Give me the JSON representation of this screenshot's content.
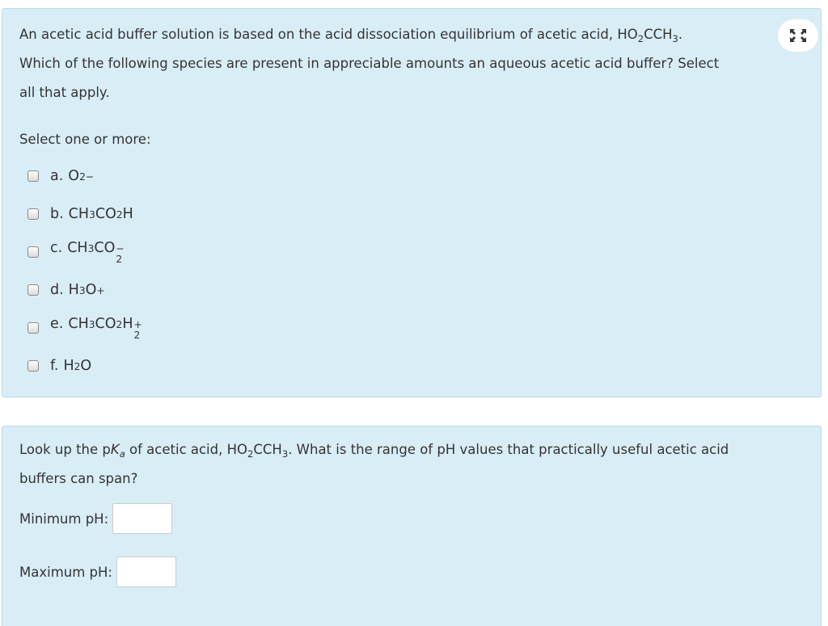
{
  "question1": {
    "line1": {
      "pre": "An acetic acid buffer solution is based on the acid dissociation equilibrium of acetic acid, HO",
      "sub1": "2",
      "mid": "CCH",
      "sub2": "3",
      "post": "."
    },
    "line2": "Which of the following species are present in appreciable amounts an aqueous acetic acid buffer? Select",
    "line3": "all that apply.",
    "prompt": "Select one or more:",
    "options": [
      {
        "letter": "a.",
        "formula": "O",
        "sup": "2−"
      },
      {
        "letter": "b.",
        "p1": "CH",
        "s1": "3",
        "p2": "CO",
        "s2": "2",
        "p3": "H"
      },
      {
        "letter": "c.",
        "p1": "CH",
        "s1": "3",
        "p2": "CO",
        "s2": "2",
        "sup": "−"
      },
      {
        "letter": "d.",
        "p1": "H",
        "s1": "3",
        "p2": "O",
        "sup": "+"
      },
      {
        "letter": "e.",
        "p1": "CH",
        "s1": "3",
        "p2": "CO",
        "s2": "2",
        "p3": "H",
        "s3": "2",
        "sup": "+"
      },
      {
        "letter": "f.",
        "p1": "H",
        "s1": "2",
        "p2": "O"
      }
    ]
  },
  "question2": {
    "line1": {
      "pre": "Look up the p",
      "italic": "K",
      "italic_sub": "a",
      "mid": " of acetic acid, HO",
      "sub1": "2",
      "mid2": "CCH",
      "sub2": "3",
      "post": ". What is the range of pH values that practically useful acetic acid"
    },
    "line2": "buffers can span?",
    "min_label": "Minimum pH:",
    "min_value": "",
    "max_label": "Maximum pH:",
    "max_value": ""
  },
  "icons": {
    "expand": "fullscreen-expand-icon"
  },
  "colors": {
    "panel_bg": "#d9edf7",
    "panel_border": "#b5dcea",
    "text": "#333333"
  }
}
